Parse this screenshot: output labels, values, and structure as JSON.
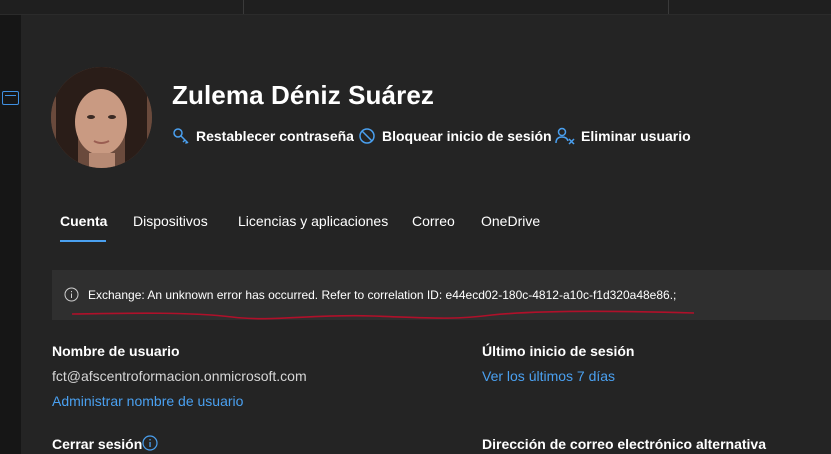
{
  "profile": {
    "display_name": "Zulema Déniz Suárez",
    "actions": [
      {
        "label": "Restablecer contraseña",
        "icon": "key-icon"
      },
      {
        "label": "Bloquear inicio de sesión",
        "icon": "block-icon"
      },
      {
        "label": "Eliminar usuario",
        "icon": "remove-user-icon"
      }
    ]
  },
  "tabs": [
    {
      "label": "Cuenta",
      "active": true
    },
    {
      "label": "Dispositivos"
    },
    {
      "label": "Licencias y aplicaciones"
    },
    {
      "label": "Correo"
    },
    {
      "label": "OneDrive"
    }
  ],
  "banner": {
    "icon": "info-icon",
    "message": "Exchange: An unknown error has occurred. Refer to correlation ID: e44ecd02-180c-4812-a10c-f1d320a48e86.;"
  },
  "account": {
    "username_label": "Nombre de usuario",
    "username_value": "fct@afscentroformacion.onmicrosoft.com",
    "manage_username_link": "Administrar nombre de usuario",
    "last_signin_label": "Último inicio de sesión",
    "last_signin_link": "Ver los últimos 7 días",
    "signout_label": "Cerrar sesión",
    "alt_email_label": "Dirección de correo electrónico alternativa"
  },
  "colors": {
    "accent": "#4aa0f0",
    "background": "#242424",
    "banner_bg": "#2f2f2f",
    "squiggle": "#b0102a"
  }
}
